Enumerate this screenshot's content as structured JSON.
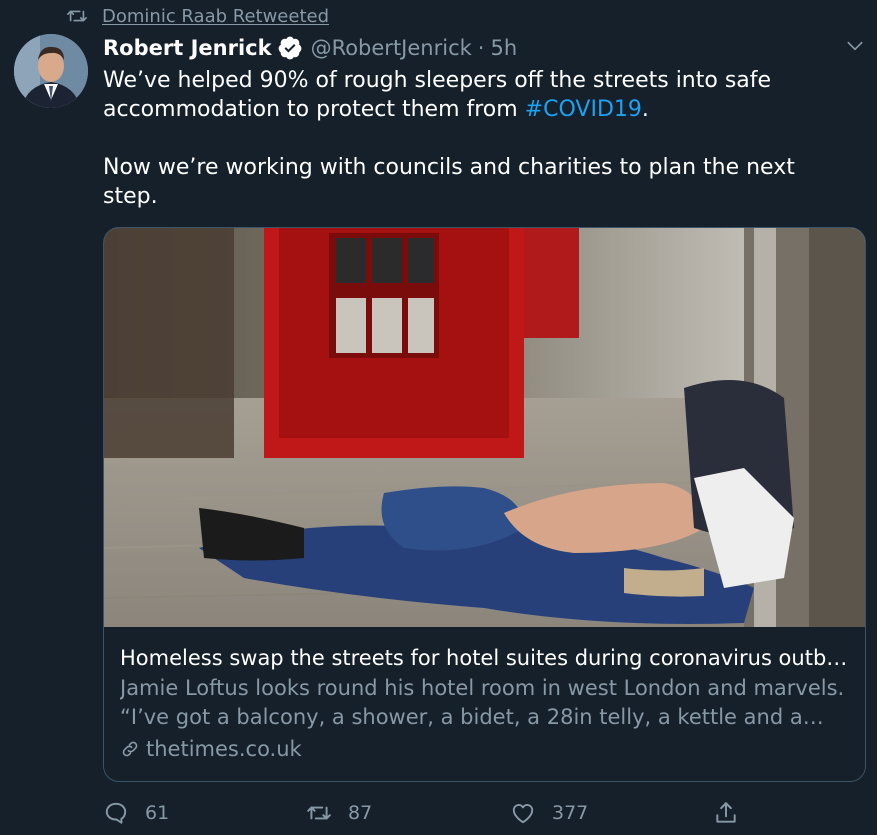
{
  "retweet_banner": {
    "label": "Dominic Raab Retweeted",
    "icon": "retweet-icon"
  },
  "tweet": {
    "author": {
      "name": "Robert Jenrick",
      "verified": true,
      "handle": "@RobertJenrick",
      "separator": "·",
      "time": "5h"
    },
    "text": {
      "line1_prefix": "We’ve helped 90% of rough sleepers off the streets into safe accommodation to protect them from ",
      "hashtag": "#COVID19",
      "line1_suffix": ".",
      "paragraph2": "Now we’re working with councils and charities to plan the next step."
    },
    "card": {
      "title": "Homeless swap the streets for hotel suites during coronavirus outbreak",
      "description": "Jamie Loftus looks round his hotel room in west London and marvels. “I’ve got a balcony, a shower, a bidet, a 28in telly, a kettle and a window”",
      "domain": "thetimes.co.uk"
    },
    "actions": {
      "replies": "61",
      "retweets": "87",
      "likes": "377"
    }
  },
  "colors": {
    "background": "#15202b",
    "secondary_text": "#8899a6",
    "link": "#1da1f2",
    "border": "#3d5466"
  }
}
